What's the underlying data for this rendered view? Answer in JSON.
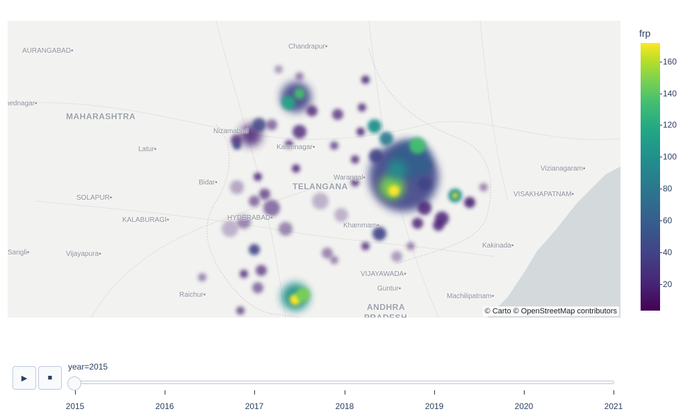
{
  "map": {
    "attribution": "© Carto © OpenStreetMap contributors",
    "basemap_labels": [
      {
        "text": "AURANGABAD",
        "kind": "city",
        "dot": true
      },
      {
        "text": "Chandrapur",
        "kind": "city",
        "dot": true
      },
      {
        "text": "mednagar",
        "kind": "city",
        "dot": true
      },
      {
        "text": "MAHARASHTRA",
        "kind": "state",
        "dot": false
      },
      {
        "text": "Nizamabad",
        "kind": "city",
        "dot": false
      },
      {
        "text": "Latur",
        "kind": "city",
        "dot": true
      },
      {
        "text": "Karimnagar",
        "kind": "city",
        "dot": true
      },
      {
        "text": "Warangal",
        "kind": "city",
        "dot": true
      },
      {
        "text": "Bidar",
        "kind": "city",
        "dot": true
      },
      {
        "text": "TELANGANA",
        "kind": "state",
        "dot": false
      },
      {
        "text": "Vizianagaram",
        "kind": "city",
        "dot": true
      },
      {
        "text": "SOLAPUR",
        "kind": "city",
        "dot": true
      },
      {
        "text": "VISAKHAPATNAM",
        "kind": "city",
        "dot": true
      },
      {
        "text": "KALABURAGI",
        "kind": "city",
        "dot": true
      },
      {
        "text": "HYDERABAD",
        "kind": "city",
        "dot": true
      },
      {
        "text": "Khammam",
        "kind": "city",
        "dot": true
      },
      {
        "text": "Kakinada",
        "kind": "city",
        "dot": true
      },
      {
        "text": "Sangli",
        "kind": "city",
        "dot": true
      },
      {
        "text": "Vijayapura",
        "kind": "city",
        "dot": true
      },
      {
        "text": "VIJAYAWADA",
        "kind": "city",
        "dot": true
      },
      {
        "text": "Guntur",
        "kind": "city",
        "dot": true
      },
      {
        "text": "Machilipatnam",
        "kind": "city",
        "dot": true
      },
      {
        "text": "Raichur",
        "kind": "city",
        "dot": true
      },
      {
        "text": "ANDHRA",
        "kind": "state",
        "dot": false
      },
      {
        "text": "PRADESH",
        "kind": "state",
        "dot": false
      }
    ]
  },
  "colorbar": {
    "title": "frp",
    "min": 4,
    "max": 172,
    "ticks": [
      "20",
      "40",
      "60",
      "80",
      "100",
      "120",
      "140",
      "160"
    ],
    "colorscale": [
      "#440154",
      "#482475",
      "#414487",
      "#355f8d",
      "#2a788e",
      "#21918c",
      "#22a884",
      "#44bf70",
      "#7ad151",
      "#bddf26",
      "#fde725"
    ]
  },
  "slider": {
    "current_label": "year=2015",
    "steps": [
      "2015",
      "2016",
      "2017",
      "2018",
      "2019",
      "2020",
      "2021"
    ],
    "play_icon": "play-icon",
    "stop_icon": "stop-icon"
  }
}
